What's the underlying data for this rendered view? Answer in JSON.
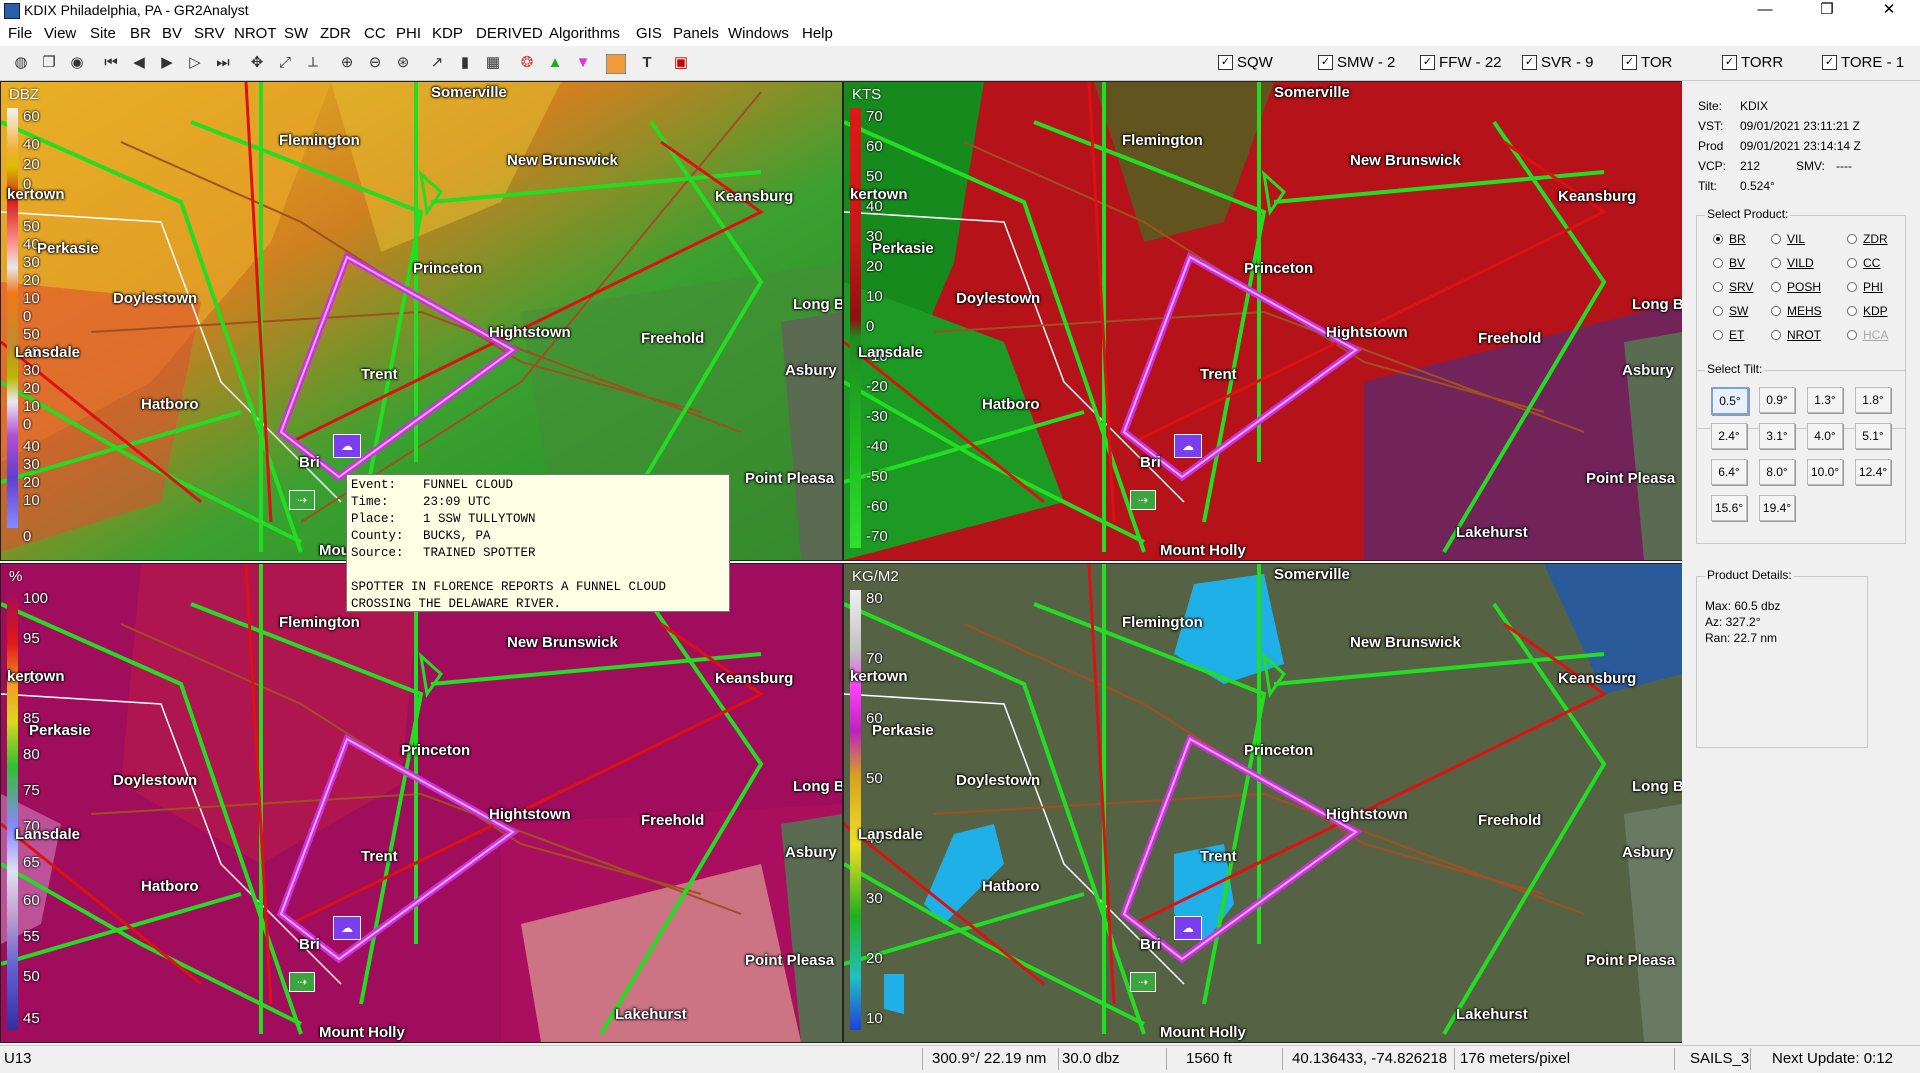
{
  "window": {
    "title": "KDIX Philadelphia, PA - GR2Analyst",
    "minimize": "—",
    "maximize": "❐",
    "close": "✕"
  },
  "menu": [
    "File",
    "View",
    "Site",
    "BR",
    "BV",
    "SRV",
    "NROT",
    "SW",
    "ZDR",
    "CC",
    "PHI",
    "KDP",
    "DERIVED",
    "Algorithms",
    "GIS",
    "Panels",
    "Windows",
    "Help"
  ],
  "layers": [
    {
      "label": "SQW",
      "checked": true
    },
    {
      "label": "SMW - 2",
      "checked": true
    },
    {
      "label": "FFW - 22",
      "checked": true
    },
    {
      "label": "SVR - 9",
      "checked": true
    },
    {
      "label": "TOR",
      "checked": true
    },
    {
      "label": "TORR",
      "checked": true
    },
    {
      "label": "TORE - 1",
      "checked": true
    }
  ],
  "panes": [
    {
      "unit": "DBZ",
      "ticks": [
        "60",
        "40",
        "20",
        "0",
        "50",
        "40",
        "30",
        "20",
        "10",
        "0",
        "50",
        "40",
        "30",
        "20",
        "10",
        "0",
        "40",
        "30",
        "20",
        "10",
        "0"
      ]
    },
    {
      "unit": "KTS",
      "ticks": [
        "70",
        "60",
        "50",
        "40",
        "30",
        "20",
        "10",
        "0",
        "-10",
        "-20",
        "-30",
        "-40",
        "-50",
        "-60",
        "-70"
      ]
    },
    {
      "unit": "%",
      "ticks": [
        "100",
        "95",
        "90",
        "85",
        "80",
        "75",
        "70",
        "65",
        "60",
        "55",
        "50",
        "45"
      ]
    },
    {
      "unit": "KG/M2",
      "ticks": [
        "80",
        "70",
        "60",
        "50",
        "40",
        "30",
        "20",
        "10"
      ]
    }
  ],
  "cities": {
    "somerville": "Somerville",
    "flemington": "Flemington",
    "new_brunswick": "New Brunswick",
    "keansburg": "Keansburg",
    "kertown": "kertown",
    "perkasie": "Perkasie",
    "princeton": "Princeton",
    "doylestown": "Doylestown",
    "long_branch": "Long B",
    "hightstown": "Hightstown",
    "freehold": "Freehold",
    "lansdale": "Lansdale",
    "asbury": "Asbury",
    "trenton": "Trent",
    "hatboro": "Hatboro",
    "bristol": "Bri",
    "point_pleasant": "Point Pleasa",
    "mount_holly": "Mount Holly",
    "lakehurst": "Lakehurst",
    "mount_holly_short": "Mou"
  },
  "popup": {
    "event_k": "Event:",
    "event_v": "FUNNEL CLOUD",
    "time_k": "Time:",
    "time_v": "23:09 UTC",
    "place_k": "Place:",
    "place_v": "1 SSW TULLYTOWN",
    "county_k": "County:",
    "county_v": "BUCKS, PA",
    "source_k": "Source:",
    "source_v": "TRAINED SPOTTER",
    "remark1": "SPOTTER IN FLORENCE REPORTS A FUNNEL CLOUD",
    "remark2": "CROSSING THE DELAWARE RIVER."
  },
  "info": {
    "site_k": "Site:",
    "site_v": "KDIX",
    "vst_k": "VST:",
    "vst_v": "09/01/2021  23:11:21 Z",
    "prod_k": "Prod",
    "prod_v": "09/01/2021  23:14:14 Z",
    "vcp_k": "VCP:",
    "vcp_v": "212",
    "smv_k": "SMV:",
    "smv_v": "----",
    "tilt_k": "Tilt:",
    "tilt_v": "0.524°"
  },
  "select_product": {
    "title": "Select Product:",
    "items": [
      {
        "label": "BR",
        "on": true
      },
      {
        "label": "VIL"
      },
      {
        "label": "ZDR"
      },
      {
        "label": "BV"
      },
      {
        "label": "VILD"
      },
      {
        "label": "CC"
      },
      {
        "label": "SRV"
      },
      {
        "label": "POSH"
      },
      {
        "label": "PHI"
      },
      {
        "label": "SW"
      },
      {
        "label": "MEHS"
      },
      {
        "label": "KDP"
      },
      {
        "label": "ET"
      },
      {
        "label": "NROT"
      },
      {
        "label": "HCA",
        "disabled": true
      }
    ]
  },
  "select_tilt": {
    "title": "Select Tilt:",
    "items": [
      "0.5°",
      "0.9°",
      "1.3°",
      "1.8°",
      "2.4°",
      "3.1°",
      "4.0°",
      "5.1°",
      "6.4°",
      "8.0°",
      "10.0°",
      "12.4°",
      "15.6°",
      "19.4°"
    ]
  },
  "product_details": {
    "title": "Product Details:",
    "max": "Max:  60.5 dbz",
    "az": "Az:   327.2°",
    "ran": "Ran:  22.7 nm"
  },
  "status": {
    "u": "U13",
    "az": "300.9°/ 22.19 nm",
    "val": "30.0 dbz",
    "alt": "1560 ft",
    "coord": "40.136433, -74.826218",
    "res": "176 meters/pixel",
    "mode": "SAILS_3",
    "next": "Next Update: 0:12"
  },
  "colors": {
    "warning_tor": "#cc30e0",
    "warning_svr": "#22dd22",
    "warning_ffw": "#dd1111",
    "road": "#a05020"
  }
}
